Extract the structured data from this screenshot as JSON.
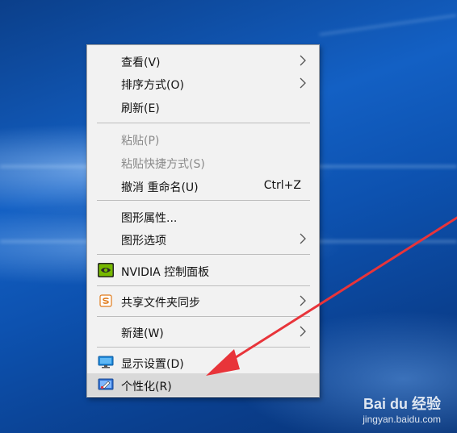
{
  "menu": {
    "view": "查看(V)",
    "sort": "排序方式(O)",
    "refresh": "刷新(E)",
    "paste": "粘贴(P)",
    "paste_shortcut": "粘贴快捷方式(S)",
    "undo": "撤消 重命名(U)",
    "undo_shortcut": "Ctrl+Z",
    "graphics_props": "图形属性...",
    "graphics_options": "图形选项",
    "nvidia": "NVIDIA 控制面板",
    "share_sync": "共享文件夹同步",
    "new": "新建(W)",
    "display": "显示设置(D)",
    "personalize": "个性化(R)"
  },
  "watermark": {
    "logo": "Bai du 经验",
    "url": "jingyan.baidu.com"
  },
  "colors": {
    "menu_bg": "#f2f2f2",
    "hover_bg": "#d9d9d9",
    "arrow": "#e8343a"
  },
  "icons": {
    "nvidia": "nvidia-icon",
    "share_sync": "sync-folder-icon",
    "display": "monitor-icon",
    "personalize": "personalize-icon"
  }
}
